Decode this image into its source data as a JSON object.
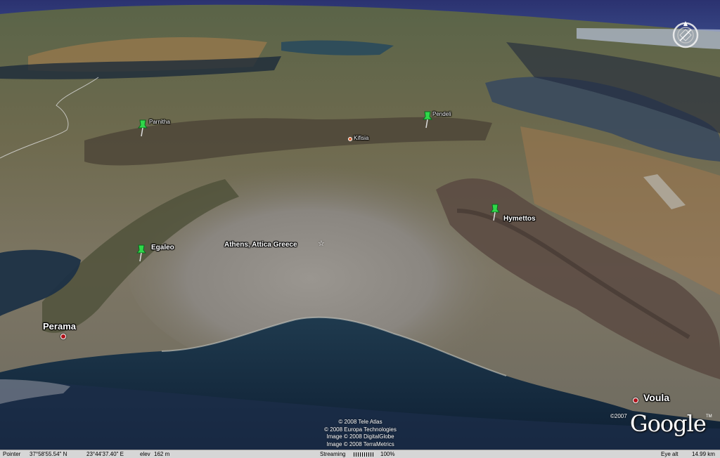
{
  "map": {
    "places": [
      {
        "id": "parnitha",
        "label": "Parnitha",
        "type": "pin"
      },
      {
        "id": "pendeli",
        "label": "Pendeli",
        "type": "pin"
      },
      {
        "id": "kifisia",
        "label": "Kifisia",
        "type": "dot"
      },
      {
        "id": "hymettos",
        "label": "Hymettos",
        "type": "pin"
      },
      {
        "id": "egaleo",
        "label": "Egaleo",
        "type": "pin"
      },
      {
        "id": "athens",
        "label": "Athens, Attica Greece",
        "type": "star"
      },
      {
        "id": "perama",
        "label": "Perama",
        "type": "city"
      },
      {
        "id": "voula",
        "label": "Voula",
        "type": "city"
      }
    ],
    "attribution": [
      "© 2008 Tele Atlas",
      "© 2008 Europa Technologies",
      "Image © 2008 DigitalGlobe",
      "Image © 2008 TerraMetrics"
    ],
    "logo": {
      "copyright": "©2007",
      "word": "Google",
      "tm": "TM"
    },
    "colors": {
      "pin": "#2fd84a",
      "city_dot": "#b0121a",
      "label": "#ffffff"
    }
  },
  "statusbar": {
    "pointer_label": "Pointer",
    "lat": "37°58'55.54\" N",
    "lon": "23°44'37.40\" E",
    "elev_label": "elev",
    "elev": "162 m",
    "streaming_label": "Streaming",
    "streaming_pct": "100%",
    "eye_alt_label": "Eye alt",
    "eye_alt": "14.99 km"
  }
}
